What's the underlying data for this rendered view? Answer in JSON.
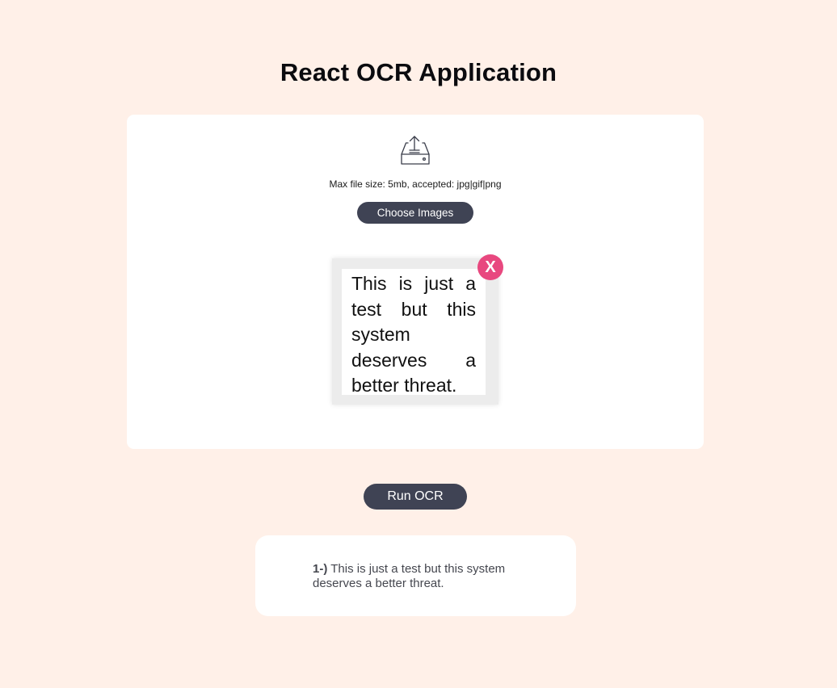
{
  "page": {
    "title": "React OCR Application",
    "background_color": "#fff0e8"
  },
  "uploader": {
    "icon": "upload-tray-icon",
    "hint": "Max file size: 5mb, accepted: jpg|gif|png",
    "choose_label": "Choose Images",
    "preview": {
      "image_text": "This is just a test but this system deserves a better threat.",
      "remove_label": "X",
      "remove_color": "#e8487f"
    }
  },
  "actions": {
    "run_label": "Run OCR",
    "button_color": "#3f4354"
  },
  "results": [
    {
      "index": "1-)",
      "text": "This is just a test but this system deserves a better threat."
    }
  ]
}
